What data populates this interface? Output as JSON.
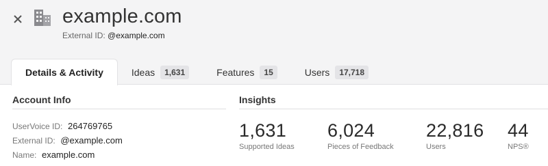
{
  "header": {
    "title": "example.com",
    "external_id_label": "External ID:",
    "external_id_value": "@example.com"
  },
  "tabs": [
    {
      "label": "Details & Activity",
      "count": "",
      "active": true
    },
    {
      "label": "Ideas",
      "count": "1,631",
      "active": false
    },
    {
      "label": "Features",
      "count": "15",
      "active": false
    },
    {
      "label": "Users",
      "count": "17,718",
      "active": false
    }
  ],
  "account_info": {
    "title": "Account Info",
    "rows": [
      {
        "key": "UserVoice ID:",
        "value": "264769765"
      },
      {
        "key": "External ID:",
        "value": "@example.com"
      },
      {
        "key": "Name:",
        "value": "example.com"
      }
    ]
  },
  "insights": {
    "title": "Insights",
    "stats": [
      {
        "value": "1,631",
        "label": "Supported Ideas"
      },
      {
        "value": "6,024",
        "label": "Pieces of Feedback"
      },
      {
        "value": "22,816",
        "label": "Users"
      },
      {
        "value": "44",
        "label": "NPS®"
      }
    ]
  },
  "colors": {
    "header_bg": "#f4f4f5",
    "badge_bg": "#e4e4e7",
    "divider": "#dedee0"
  }
}
